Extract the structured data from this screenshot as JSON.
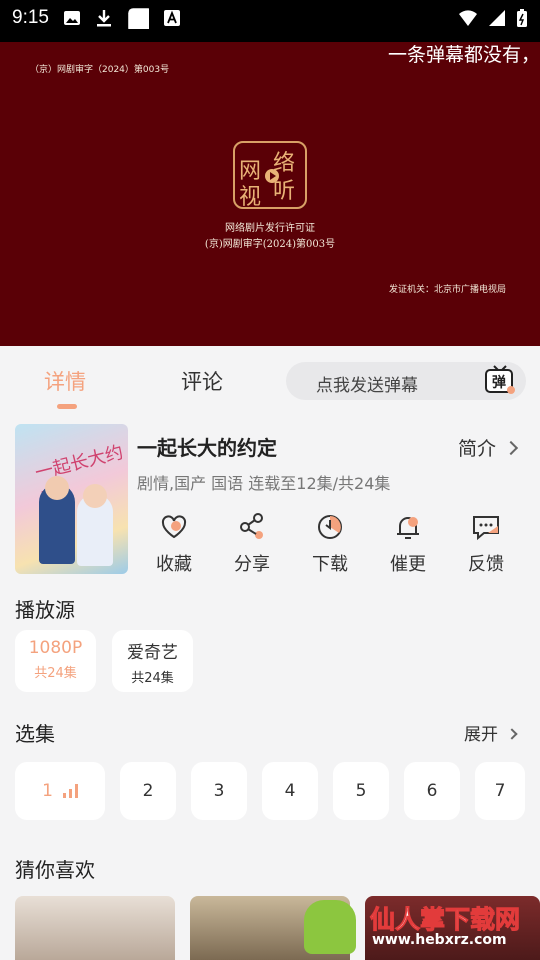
{
  "status_bar": {
    "time": "9:15",
    "left_icons": [
      "image-icon",
      "download-icon",
      "app-icon",
      "font-icon"
    ],
    "right_icons": [
      "wifi-icon",
      "signal-icon",
      "battery-icon"
    ]
  },
  "player": {
    "license_top": "（京）网剧审字（2024）第003号",
    "danmaku_text": "一条弹幕都没有，",
    "seal_chars": [
      "网",
      "络",
      "视",
      "听"
    ],
    "cert_line1": "网络剧片发行许可证",
    "cert_line2": "(京)网剧审字(2024)第003号",
    "issuer": "发证机关：北京市广播电视局",
    "background_color": "#5a0006"
  },
  "tabs": {
    "items": [
      {
        "label": "详情",
        "active": true
      },
      {
        "label": "评论",
        "active": false
      }
    ],
    "danmu_placeholder": "点我发送弹幕",
    "danmu_button_char": "弹",
    "accent": "#f4a27e"
  },
  "show": {
    "title": "一起长大的约定",
    "intro_label": "简介",
    "genres": "剧情,国产 国语 连载至12集/共24集",
    "poster_title": "一起长大约定",
    "actions": [
      {
        "label": "收藏",
        "icon": "heart-icon"
      },
      {
        "label": "分享",
        "icon": "share-icon"
      },
      {
        "label": "下载",
        "icon": "download-icon"
      },
      {
        "label": "催更",
        "icon": "bell-icon"
      },
      {
        "label": "反馈",
        "icon": "feedback-icon"
      }
    ]
  },
  "sources": {
    "title": "播放源",
    "items": [
      {
        "quality": "1080P",
        "count": "共24集",
        "active": true
      },
      {
        "quality": "爱奇艺",
        "count": "共24集",
        "active": false
      }
    ]
  },
  "episodes": {
    "title": "选集",
    "expand_label": "展开",
    "items": [
      "1",
      "2",
      "3",
      "4",
      "5",
      "6",
      "7"
    ],
    "current": "1"
  },
  "recommend": {
    "title": "猜你喜欢"
  },
  "watermark": {
    "text": "仙人掌下载网",
    "url": "www.hebxrz.com"
  }
}
